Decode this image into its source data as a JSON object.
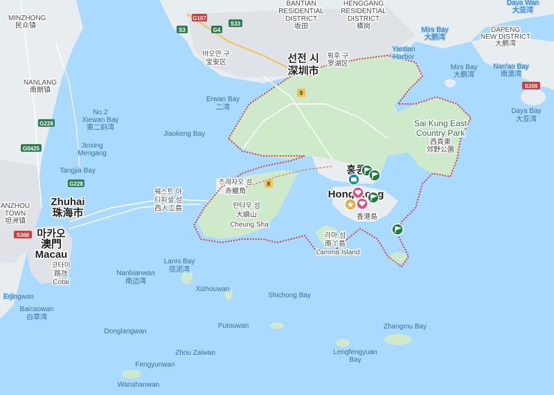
{
  "colors": {
    "water": "#aadaff",
    "land": "#e8eef0",
    "urban": "#dfe3e8",
    "park": "#cfeacb",
    "border": "#d23b3b",
    "road": "#ffffff",
    "highway": "#f2c14e",
    "marker_green": "#1e7a3e",
    "marker_pink": "#e8487a",
    "marker_teal": "#1596a6",
    "marker_orange": "#f0a431"
  },
  "labels": {
    "minzhong": "MINZHONG",
    "minzhong_cn": "民众镇",
    "bantian": "BANTIAN",
    "bantian2": "RESIDENTIAL",
    "bantian3": "DISTRICT",
    "bantian_cn": "坂田",
    "henggang": "HENGGANG",
    "henggang2": "RESIDENTIAL",
    "henggang3": "DISTRICT",
    "henggang_cn": "横岗",
    "dayawan": "Daya Wan",
    "dayawan_cn": "大亚湾",
    "dapeng": "DAPENG",
    "dapeng2": "NEW DISTRICT",
    "dapeng_cn": "大鹏湾",
    "mirsbay_top": "Mirs Bay",
    "mirsbay_top_cn": "大鹏湾",
    "bao_an_kr": "바오안 구",
    "bao_an_cn": "宝安区",
    "shenzhen_kr": "선전 시",
    "shenzhen_cn": "深圳市",
    "luohu_kr": "뤄후 구",
    "luohu_cn": "罗湖区",
    "yantian": "Yantian",
    "yantian_harbor": "Harbor",
    "mirsbay": "Mirs Bay",
    "mirsbay_cn": "大鹏湾",
    "nanao": "Nan'ao Bay",
    "nanao_cn": "南澳湾",
    "dayabay": "Daya Bay",
    "dayabay_cn": "大亚湾",
    "nanlang": "NANLANG",
    "nanlang_cn": "南朗镇",
    "erwan": "Erwan Bay",
    "erwan_cn": "二湾",
    "no2xiewan": "No.2",
    "no2xiewan2": "Xiewan Bay",
    "no2xiewan_cn": "第二斜湾",
    "jiaokeng": "Jiaokeng Bay",
    "jinxing": "Jinxing",
    "mengang": "Mengang",
    "tangjia": "Tangjia Bay",
    "saikung": "Sai Kung East",
    "saikung2": "Country Park",
    "saikung_cn": "西貢東",
    "saikung_cn2": "郊野公園",
    "chek_kr": "츠레자오 섬",
    "chek_cn": "赤鱲角",
    "hongkong_kr": "홍콩",
    "hongkong": "Hong Kong",
    "hongkong_cn": "香港島",
    "macau_airport_kr": "웨스트 아",
    "macau_airport_kr2": "티피셜 섬",
    "macau_airport_cn": "西人工島",
    "lantau_kr": "란타우 섬",
    "lantau_cn": "大嶼山",
    "cheungsha": "Cheung Sha",
    "lamma_kr": "라마 섬",
    "lamma_cn": "南丫島",
    "lamma": "Lamma Island",
    "zhuhai": "Zhuhai",
    "zhuhai_cn": "珠海市",
    "macau_kr": "마카오",
    "macau_cn": "澳門",
    "macau": "Macau",
    "cotai_kr": "코타이",
    "cotai_cn": "路氹",
    "cotai": "Cotai",
    "anzhou": "ANZHOU",
    "anzhou2": "TOWN",
    "anzhou_cn": "坦洲镇",
    "lanni": "Lanni Bay",
    "lanni_cn": "揽泥湾",
    "nanbianwan": "Nanbianwan",
    "nanbianwan_cn": "南边湾",
    "xizhouwan": "Xizhouwan",
    "shichong": "Shichong Bay",
    "erjingwan": "Erjingwan",
    "baicaowan": "Baicaowan",
    "baicaowan_cn": "白草湾",
    "donglangwan": "Donglangwan",
    "putouwan": "Putouwan",
    "zhangmu": "Zhangmu Bay",
    "zhouzaiwan": "Zhou Zaiwan",
    "lengfengyuan": "Lengfengyuan",
    "lengfengyuan2": "Bay",
    "fengyunwan": "Fengyunwan",
    "wanshanwan": "Wanshanwan"
  },
  "shields": {
    "g107": "G107",
    "s3": "S3",
    "g4": "G4",
    "s33": "S33",
    "g228a": "G228",
    "g0425": "G0425",
    "g228b": "G228",
    "s359": "S359",
    "s366": "S366",
    "r9": "9",
    "r8": "8"
  },
  "markers": [
    {
      "name": "marker-green-1",
      "color": "green",
      "icon": "flag-icon"
    },
    {
      "name": "marker-green-2",
      "color": "green",
      "icon": "flag-icon"
    },
    {
      "name": "marker-teal",
      "color": "teal",
      "icon": "bag-icon"
    },
    {
      "name": "marker-pink-1",
      "color": "pink",
      "icon": "heart-icon"
    },
    {
      "name": "marker-orange",
      "color": "orange",
      "icon": "star-icon"
    },
    {
      "name": "marker-pink-2",
      "color": "pink",
      "icon": "heart-icon"
    },
    {
      "name": "marker-green-3",
      "color": "green",
      "icon": "flag-icon"
    },
    {
      "name": "marker-green-4",
      "color": "green",
      "icon": "flag-icon"
    }
  ]
}
